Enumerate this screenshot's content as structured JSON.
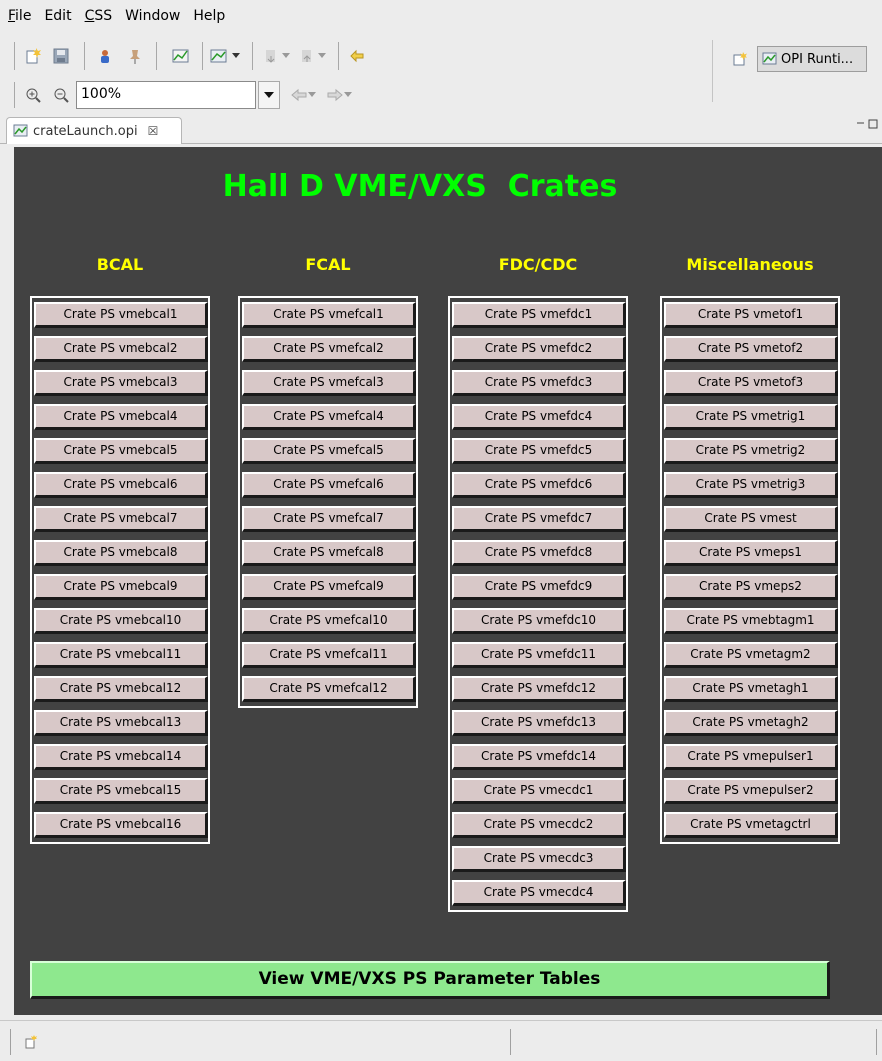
{
  "menu": [
    {
      "underline": "F",
      "rest": "ile"
    },
    {
      "underline": "",
      "rest": "Edit"
    },
    {
      "underline": "C",
      "rest": "SS"
    },
    {
      "underline": "",
      "rest": "Window"
    },
    {
      "underline": "",
      "rest": "Help"
    }
  ],
  "toolbar": {
    "zoom_value": "100%"
  },
  "perspective": {
    "label": "OPI Runti..."
  },
  "editor_tab": {
    "label": "crateLaunch.opi",
    "close": "☒"
  },
  "canvas": {
    "title": "Hall D VME/VXS  Crates",
    "columns": [
      {
        "heading": "BCAL",
        "buttons": [
          "Crate PS vmebcal1",
          "Crate PS vmebcal2",
          "Crate PS vmebcal3",
          "Crate PS vmebcal4",
          "Crate PS vmebcal5",
          "Crate PS vmebcal6",
          "Crate PS vmebcal7",
          "Crate PS vmebcal8",
          "Crate PS vmebcal9",
          "Crate PS vmebcal10",
          "Crate PS vmebcal11",
          "Crate PS vmebcal12",
          "Crate PS vmebcal13",
          "Crate PS vmebcal14",
          "Crate PS vmebcal15",
          "Crate PS vmebcal16"
        ]
      },
      {
        "heading": "FCAL",
        "buttons": [
          "Crate PS vmefcal1",
          "Crate PS vmefcal2",
          "Crate PS vmefcal3",
          "Crate PS vmefcal4",
          "Crate PS vmefcal5",
          "Crate PS vmefcal6",
          "Crate PS vmefcal7",
          "Crate PS vmefcal8",
          "Crate PS vmefcal9",
          "Crate PS vmefcal10",
          "Crate PS vmefcal11",
          "Crate PS vmefcal12"
        ]
      },
      {
        "heading": "FDC/CDC",
        "buttons": [
          "Crate PS vmefdc1",
          "Crate PS vmefdc2",
          "Crate PS vmefdc3",
          "Crate PS vmefdc4",
          "Crate PS vmefdc5",
          "Crate PS vmefdc6",
          "Crate PS vmefdc7",
          "Crate PS vmefdc8",
          "Crate PS vmefdc9",
          "Crate PS vmefdc10",
          "Crate PS vmefdc11",
          "Crate PS vmefdc12",
          "Crate PS vmefdc13",
          "Crate PS vmefdc14",
          "Crate PS vmecdc1",
          "Crate PS vmecdc2",
          "Crate PS vmecdc3",
          "Crate PS vmecdc4"
        ]
      },
      {
        "heading": "Miscellaneous",
        "buttons": [
          "Crate PS vmetof1",
          "Crate PS vmetof2",
          "Crate PS vmetof3",
          "Crate PS vmetrig1",
          "Crate PS vmetrig2",
          "Crate PS vmetrig3",
          "Crate PS vmest",
          "Crate PS vmeps1",
          "Crate PS vmeps2",
          "Crate PS vmebtagm1",
          "Crate PS vmetagm2",
          "Crate PS vmetagh1",
          "Crate PS vmetagh2",
          "Crate PS vmepulser1",
          "Crate PS vmepulser2",
          "Crate PS vmetagctrl"
        ]
      }
    ],
    "bottom_button": "View VME/VXS PS Parameter Tables"
  },
  "colors": {
    "canvas_bg": "#424242",
    "title": "#00ff00",
    "heading": "#ffff00",
    "crate_button": "#d8c8c8",
    "bottom_button": "#8ee88e"
  }
}
